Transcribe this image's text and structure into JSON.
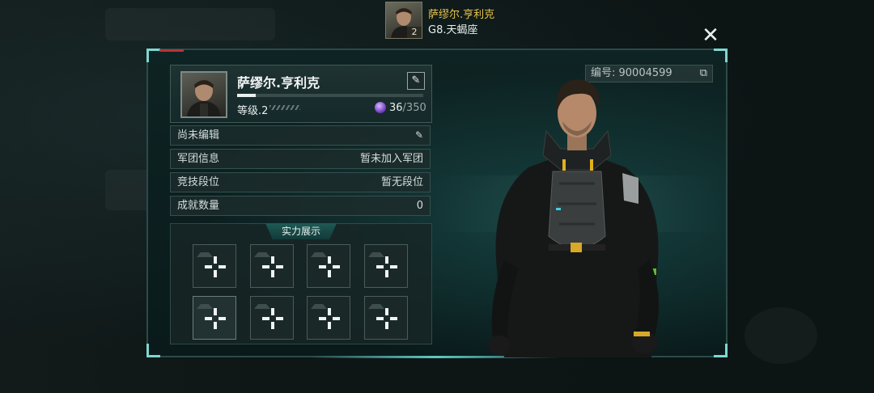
{
  "header": {
    "player_name": "萨缪尔.亨利克",
    "player_level": "2",
    "server_info": "G8.天蝎座",
    "close_label": "✕"
  },
  "profile": {
    "name": "萨缪尔.亨利克",
    "level_label": "等级.2",
    "exp_progress": 0.1,
    "gem_current": "36",
    "gem_max": "/350"
  },
  "id_box": {
    "text": "编号: 90004599"
  },
  "info_rows": [
    {
      "label": "尚未编辑",
      "value": ""
    },
    {
      "label": "军团信息",
      "value": "暂未加入军团"
    },
    {
      "label": "竞技段位",
      "value": "暂无段位"
    },
    {
      "label": "成就数量",
      "value": "0"
    }
  ],
  "showcase": {
    "title": "实力展示",
    "slot_count": 8
  },
  "colors": {
    "accent": "#7fd6cf",
    "name_gold": "#e6c34a",
    "gem_purple": "#7a45c8"
  }
}
